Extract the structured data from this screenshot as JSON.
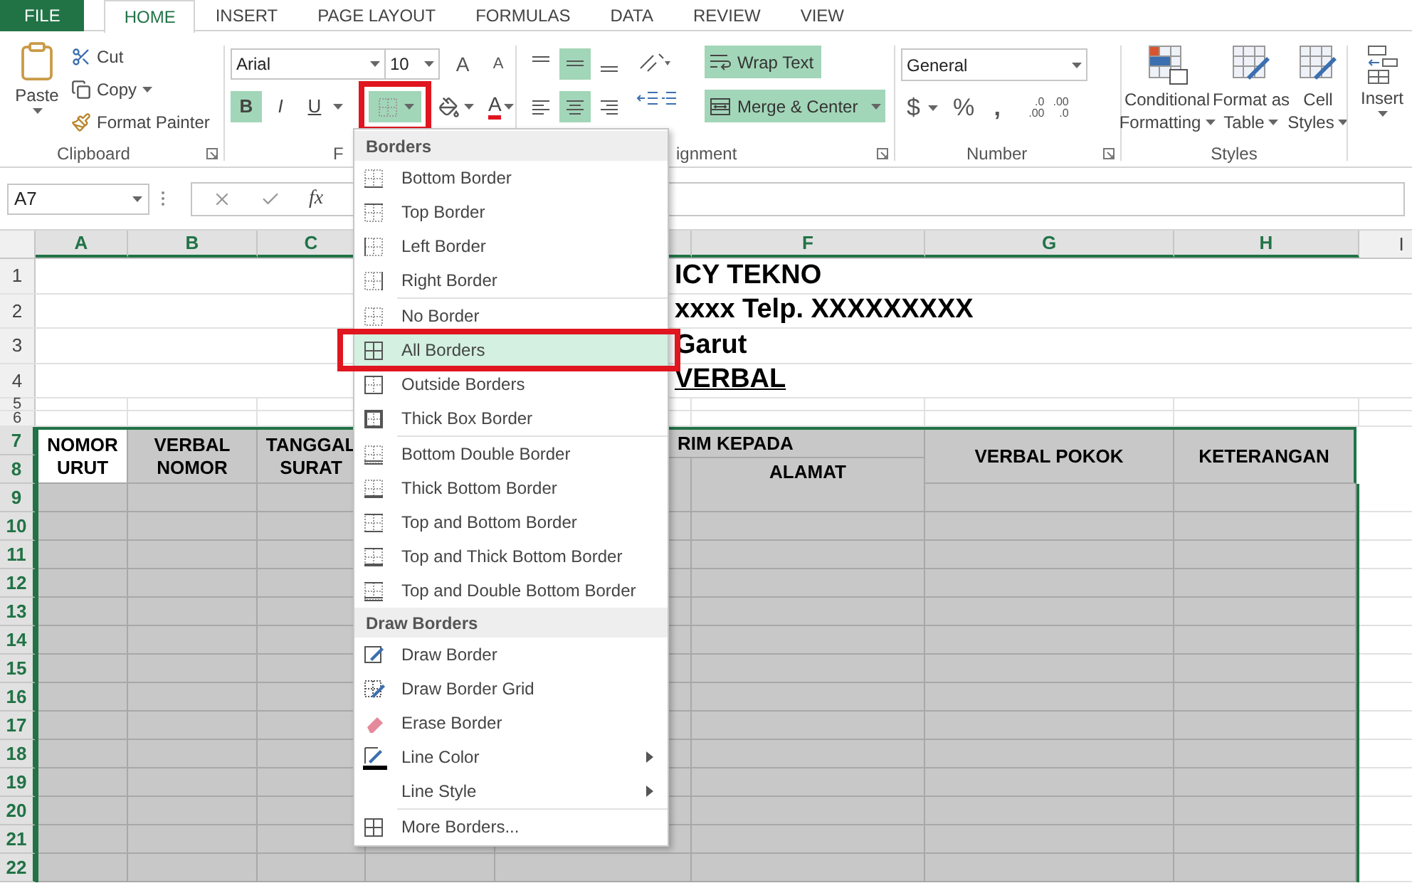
{
  "tabs": [
    {
      "label": "FILE",
      "kind": "file",
      "selected": false
    },
    {
      "label": "HOME",
      "kind": "tab",
      "selected": true
    },
    {
      "label": "INSERT",
      "kind": "tab",
      "selected": false
    },
    {
      "label": "PAGE LAYOUT",
      "kind": "tab",
      "selected": false
    },
    {
      "label": "FORMULAS",
      "kind": "tab",
      "selected": false
    },
    {
      "label": "DATA",
      "kind": "tab",
      "selected": false
    },
    {
      "label": "REVIEW",
      "kind": "tab",
      "selected": false
    },
    {
      "label": "VIEW",
      "kind": "tab",
      "selected": false
    }
  ],
  "clipboard": {
    "paste": "Paste",
    "cut": "Cut",
    "copy": "Copy",
    "format_painter": "Format Painter",
    "label": "Clipboard"
  },
  "font": {
    "name": "Arial",
    "size": "10",
    "grow": "A",
    "shrink": "A",
    "bold_label": "B",
    "italic_label": "I",
    "underline_label": "U",
    "bold": true,
    "italic": false,
    "underline": false,
    "borders_open": true,
    "borders_highlighted": true,
    "font_color_label": "A",
    "label": "F"
  },
  "alignment": {
    "align_middle": true,
    "align_center": true,
    "wrap_text": "Wrap Text",
    "wrap_on": true,
    "merge": "Merge & Center",
    "merge_on": true,
    "label": "ignment"
  },
  "number": {
    "format": "General",
    "currency": "$",
    "percent": "%",
    "comma": ",",
    "inc_decimal": [
      ".0",
      ".00"
    ],
    "dec_decimal": [
      ".00",
      ".0"
    ],
    "label": "Number"
  },
  "styles": {
    "items": [
      {
        "lines": [
          "Conditional",
          "Formatting"
        ]
      },
      {
        "lines": [
          "Format as",
          "Table"
        ]
      },
      {
        "lines": [
          "Cell",
          "Styles"
        ]
      }
    ],
    "label": "Styles"
  },
  "cells": {
    "insert": "Insert"
  },
  "formula_bar": {
    "name_box": "A7",
    "fx": "fx"
  },
  "columns": [
    {
      "label": "A",
      "selected": true
    },
    {
      "label": "B",
      "selected": true
    },
    {
      "label": "C",
      "selected": true
    },
    {
      "label": "F",
      "selected": true
    },
    {
      "label": "G",
      "selected": true
    },
    {
      "label": "H",
      "selected": true
    },
    {
      "label": "I",
      "selected": false
    }
  ],
  "title_lines": [
    {
      "row": "1",
      "text": "ICY TEKNO",
      "underline": false
    },
    {
      "row": "2",
      "text": "xxxx Telp. XXXXXXXXX",
      "underline": false
    },
    {
      "row": "3",
      "text": "Garut",
      "underline": false
    },
    {
      "row": "4",
      "text": "VERBAL",
      "underline": true
    }
  ],
  "spacer_rows": [
    {
      "row": "5"
    },
    {
      "row": "6"
    }
  ],
  "table_header": {
    "rows": [
      "7",
      "8"
    ],
    "nomor": [
      "NOMOR",
      "URUT"
    ],
    "verbal_nomor": [
      "VERBAL",
      "NOMOR"
    ],
    "tanggal": [
      "TANGGAL",
      "SURAT"
    ],
    "kirim": "RIM KEPADA",
    "alamat": "ALAMAT",
    "pokok": "VERBAL POKOK",
    "keterangan": "KETERANGAN"
  },
  "body_rows": [
    "9",
    "10",
    "11",
    "12",
    "13",
    "14",
    "15",
    "16",
    "17",
    "18",
    "19",
    "20",
    "21",
    "22"
  ],
  "menu": {
    "sections": [
      {
        "title": "Borders",
        "groups": [
          [
            {
              "label": "Bottom Border",
              "selected": false,
              "highlighted": false,
              "submenu": false
            },
            {
              "label": "Top Border",
              "selected": false,
              "highlighted": false,
              "submenu": false
            },
            {
              "label": "Left Border",
              "selected": false,
              "highlighted": false,
              "submenu": false
            },
            {
              "label": "Right Border",
              "selected": false,
              "highlighted": false,
              "submenu": false
            }
          ],
          [
            {
              "label": "No Border",
              "selected": false,
              "highlighted": false,
              "submenu": false
            },
            {
              "label": "All Borders",
              "selected": true,
              "highlighted": true,
              "submenu": false
            },
            {
              "label": "Outside Borders",
              "selected": false,
              "highlighted": false,
              "submenu": false
            },
            {
              "label": "Thick Box Border",
              "selected": false,
              "highlighted": false,
              "submenu": false
            }
          ],
          [
            {
              "label": "Bottom Double Border",
              "selected": false,
              "highlighted": false,
              "submenu": false
            },
            {
              "label": "Thick Bottom Border",
              "selected": false,
              "highlighted": false,
              "submenu": false
            },
            {
              "label": "Top and Bottom Border",
              "selected": false,
              "highlighted": false,
              "submenu": false
            },
            {
              "label": "Top and Thick Bottom Border",
              "selected": false,
              "highlighted": false,
              "submenu": false
            },
            {
              "label": "Top and Double Bottom Border",
              "selected": false,
              "highlighted": false,
              "submenu": false
            }
          ]
        ]
      },
      {
        "title": "Draw Borders",
        "groups": [
          [
            {
              "label": "Draw Border",
              "selected": false,
              "highlighted": false,
              "submenu": false
            },
            {
              "label": "Draw Border Grid",
              "selected": false,
              "highlighted": false,
              "submenu": false
            },
            {
              "label": "Erase Border",
              "selected": false,
              "highlighted": false,
              "submenu": false
            },
            {
              "label": "Line Color",
              "selected": false,
              "highlighted": false,
              "submenu": true
            },
            {
              "label": "Line Style",
              "selected": false,
              "highlighted": false,
              "submenu": true
            }
          ],
          [
            {
              "label": "More Borders...",
              "selected": false,
              "highlighted": false,
              "submenu": false
            }
          ]
        ]
      }
    ]
  }
}
